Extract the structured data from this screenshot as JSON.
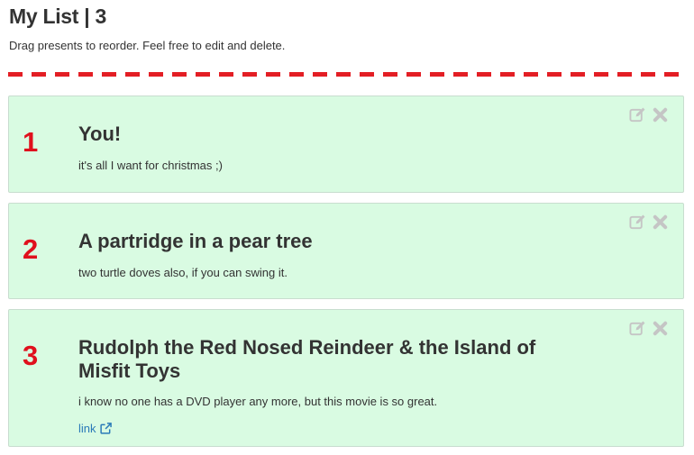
{
  "header": {
    "title": "My List | 3",
    "subtitle": "Drag presents to reorder. Feel free to edit and delete."
  },
  "colors": {
    "accent": "#e0101d",
    "card_background": "#d9fbe2",
    "card_border": "#c8ddcf",
    "link": "#2a7ab8",
    "action_icon": "#c5c5c5"
  },
  "icons": [
    "edit-icon",
    "delete-icon",
    "external-link-icon"
  ],
  "presents": [
    {
      "rank": "1",
      "title": "You!",
      "description": "it's all I want for christmas ;)"
    },
    {
      "rank": "2",
      "title": "A partridge in a pear tree",
      "description": "two turtle doves also, if you can swing it."
    },
    {
      "rank": "3",
      "title": "Rudolph the Red Nosed Reindeer & the Island of Misfit Toys",
      "description": "i know no one has a DVD player any more, but this movie is so great.",
      "link_label": "link"
    }
  ]
}
